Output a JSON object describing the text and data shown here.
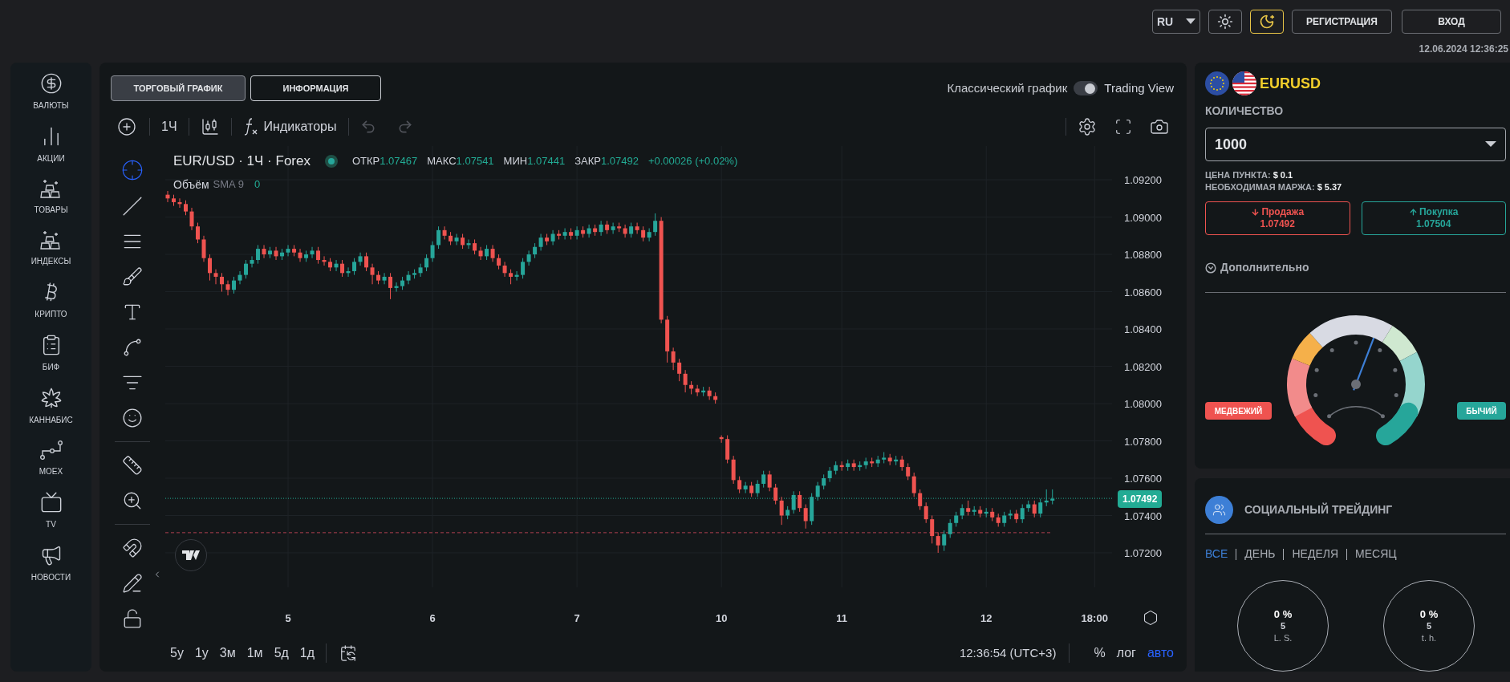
{
  "header": {
    "language": "RU",
    "theme_buttons": [
      {
        "kind": "light",
        "selected": false
      },
      {
        "kind": "dark",
        "selected": true
      }
    ],
    "buttons": [
      "РЕГИСТРАЦИЯ",
      "ВХОД"
    ],
    "datetime": "12.06.2024 12:36:25"
  },
  "sidebar": {
    "items": [
      {
        "label": "ВАЛЮТЫ"
      },
      {
        "label": "АКЦИИ"
      },
      {
        "label": "ТОВАРЫ"
      },
      {
        "label": "ИНДЕКСЫ"
      },
      {
        "label": "КРИПТО"
      },
      {
        "label": "БИФ"
      },
      {
        "label": "КАННАБИС"
      },
      {
        "label": "MOEX"
      },
      {
        "label": "TV"
      },
      {
        "label": "НОВОСТИ"
      }
    ]
  },
  "chart_panel": {
    "tabs": [
      {
        "label": "ТОРГОВЫЙ ГРАФИК",
        "selected": true
      },
      {
        "label": "ИНФОРМАЦИЯ",
        "selected": false
      }
    ],
    "view_toggle": {
      "left_label": "Классический график",
      "right_label": "Trading View",
      "on": true
    },
    "toolbar": {
      "interval": "1Ч",
      "indicators": "Индикаторы"
    },
    "drawing_tools": [
      {
        "selected": true
      },
      {
        "selected": false
      },
      {
        "selected": false
      },
      {
        "selected": false
      },
      {
        "selected": false
      },
      {
        "selected": false
      },
      {
        "selected": false
      },
      {
        "selected": false
      },
      {
        "selected": false
      },
      {
        "selected": false
      },
      {
        "selected": false
      },
      {
        "selected": false
      },
      {
        "selected": false
      }
    ],
    "legend": {
      "symbol": "EUR/USD · 1Ч · Forex",
      "values": [
        {
          "label": "ОТКР",
          "value": "1.07467"
        },
        {
          "label": "МАКС",
          "value": "1.07541"
        },
        {
          "label": "МИН",
          "value": "1.07441"
        },
        {
          "label": "ЗАКР",
          "value": "1.07492"
        }
      ],
      "change": "+0.00026 (+0.02%)",
      "volume_label": "Объём",
      "sma": "SMA 9",
      "volume_value": "0"
    },
    "chart_data": {
      "type": "candlestick",
      "ylim": [
        1.07015,
        1.09381
      ],
      "grid": true,
      "ref_lines": [
        {
          "axis": "y",
          "value": 1.07492,
          "color": "#22ab94"
        },
        {
          "axis": "y",
          "value": 1.07308,
          "color": "#b04050"
        }
      ],
      "yticks": [
        {
          "value": 1.092,
          "label": "1.09200"
        },
        {
          "value": 1.09,
          "label": "1.09000"
        },
        {
          "value": 1.088,
          "label": "1.08800"
        },
        {
          "value": 1.086,
          "label": "1.08600"
        },
        {
          "value": 1.084,
          "label": "1.08400"
        },
        {
          "value": 1.082,
          "label": "1.08200"
        },
        {
          "value": 1.08,
          "label": "1.08000"
        },
        {
          "value": 1.078,
          "label": "1.07800"
        },
        {
          "value": 1.076,
          "label": "1.07600"
        },
        {
          "value": 1.074,
          "label": "1.07400"
        },
        {
          "value": 1.072,
          "label": "1.07200"
        }
      ],
      "categories": [
        null,
        null,
        null,
        null,
        null,
        null,
        null,
        null,
        null,
        null,
        null,
        null,
        null,
        null,
        null,
        null,
        null,
        null,
        null,
        null,
        "5",
        null,
        null,
        null,
        null,
        null,
        null,
        null,
        null,
        null,
        null,
        null,
        null,
        null,
        null,
        null,
        null,
        null,
        null,
        null,
        null,
        null,
        null,
        null,
        "6",
        null,
        null,
        null,
        null,
        null,
        null,
        null,
        null,
        null,
        null,
        null,
        null,
        null,
        null,
        null,
        null,
        null,
        null,
        null,
        null,
        null,
        null,
        null,
        "7",
        null,
        null,
        null,
        null,
        null,
        null,
        null,
        null,
        null,
        null,
        null,
        null,
        null,
        null,
        null,
        null,
        null,
        null,
        null,
        null,
        null,
        null,
        null,
        "10",
        null,
        null,
        null,
        null,
        null,
        null,
        null,
        null,
        null,
        null,
        null,
        null,
        null,
        null,
        null,
        null,
        null,
        null,
        null,
        "11",
        null,
        null,
        null,
        null,
        null,
        null,
        null,
        null,
        null,
        null,
        null,
        null,
        null,
        null,
        null,
        null,
        null,
        null,
        null,
        null,
        null,
        null,
        null,
        "12",
        null,
        null,
        null,
        null,
        null,
        null,
        null,
        null,
        null,
        null,
        null,
        null,
        null,
        null,
        null,
        null,
        null,
        "18:00"
      ],
      "ohlc": [
        [
          1.0912,
          1.0914,
          1.0908,
          1.091
        ],
        [
          1.091,
          1.0912,
          1.0906,
          1.0908
        ],
        [
          1.0908,
          1.091,
          1.0905,
          1.0907
        ],
        [
          1.0907,
          1.0909,
          1.0901,
          1.0903
        ],
        [
          1.0903,
          1.0905,
          1.0893,
          1.0895
        ],
        [
          1.0895,
          1.0897,
          1.0886,
          1.0888
        ],
        [
          1.0888,
          1.089,
          1.0876,
          1.0878
        ],
        [
          1.0878,
          1.088,
          1.0866,
          1.087
        ],
        [
          1.087,
          1.0872,
          1.0864,
          1.0868
        ],
        [
          1.0868,
          1.087,
          1.086,
          1.0864
        ],
        [
          1.0864,
          1.0866,
          1.0858,
          1.0861
        ],
        [
          1.0861,
          1.0868,
          1.0859,
          1.0866
        ],
        [
          1.0866,
          1.0871,
          1.0864,
          1.0869
        ],
        [
          1.0869,
          1.0877,
          1.0867,
          1.0875
        ],
        [
          1.0875,
          1.0879,
          1.0873,
          1.0877
        ],
        [
          1.0877,
          1.0885,
          1.0875,
          1.0883
        ],
        [
          1.0883,
          1.0885,
          1.0878,
          1.088
        ],
        [
          1.088,
          1.0884,
          1.0878,
          1.0882
        ],
        [
          1.0882,
          1.0884,
          1.0877,
          1.0879
        ],
        [
          1.0879,
          1.0883,
          1.0877,
          1.0881
        ],
        [
          1.0881,
          1.0885,
          1.0879,
          1.0883
        ],
        [
          1.0883,
          1.0885,
          1.0879,
          1.0881
        ],
        [
          1.0881,
          1.0883,
          1.0876,
          1.0878
        ],
        [
          1.0878,
          1.0882,
          1.0876,
          1.088
        ],
        [
          1.088,
          1.0884,
          1.0878,
          1.0882
        ],
        [
          1.0882,
          1.0884,
          1.0875,
          1.0877
        ],
        [
          1.0877,
          1.0879,
          1.0874,
          1.0876
        ],
        [
          1.0876,
          1.0878,
          1.0871,
          1.0873
        ],
        [
          1.0873,
          1.0877,
          1.0871,
          1.0875
        ],
        [
          1.0875,
          1.0877,
          1.0868,
          1.087
        ],
        [
          1.087,
          1.0873,
          1.0868,
          1.0871
        ],
        [
          1.0871,
          1.0878,
          1.0869,
          1.0876
        ],
        [
          1.0876,
          1.0881,
          1.0874,
          1.0879
        ],
        [
          1.0879,
          1.0881,
          1.0871,
          1.0873
        ],
        [
          1.0873,
          1.0875,
          1.0864,
          1.0869
        ],
        [
          1.0869,
          1.0871,
          1.0864,
          1.0866
        ],
        [
          1.0866,
          1.087,
          1.0864,
          1.0868
        ],
        [
          1.0868,
          1.087,
          1.0856,
          1.0862
        ],
        [
          1.0862,
          1.0865,
          1.086,
          1.0863
        ],
        [
          1.0863,
          1.0868,
          1.0861,
          1.0866
        ],
        [
          1.0866,
          1.0871,
          1.0864,
          1.0869
        ],
        [
          1.0869,
          1.0872,
          1.0867,
          1.087
        ],
        [
          1.087,
          1.0875,
          1.0868,
          1.0873
        ],
        [
          1.0873,
          1.088,
          1.0871,
          1.0878
        ],
        [
          1.0878,
          1.0887,
          1.0876,
          1.0885
        ],
        [
          1.0885,
          1.0895,
          1.0883,
          1.0893
        ],
        [
          1.0893,
          1.0895,
          1.0888,
          1.089
        ],
        [
          1.089,
          1.0892,
          1.0885,
          1.0887
        ],
        [
          1.0887,
          1.0891,
          1.0885,
          1.0889
        ],
        [
          1.0889,
          1.0891,
          1.0883,
          1.0885
        ],
        [
          1.0885,
          1.0888,
          1.0883,
          1.0886
        ],
        [
          1.0886,
          1.0888,
          1.088,
          1.0882
        ],
        [
          1.0882,
          1.0884,
          1.0877,
          1.0879
        ],
        [
          1.0879,
          1.0885,
          1.0877,
          1.0883
        ],
        [
          1.0883,
          1.0885,
          1.0876,
          1.0878
        ],
        [
          1.0878,
          1.088,
          1.0872,
          1.0874
        ],
        [
          1.0874,
          1.0876,
          1.0868,
          1.087
        ],
        [
          1.087,
          1.0872,
          1.0864,
          1.0868
        ],
        [
          1.0868,
          1.0871,
          1.0866,
          1.0869
        ],
        [
          1.0869,
          1.0878,
          1.0867,
          1.0876
        ],
        [
          1.0876,
          1.0882,
          1.0874,
          1.088
        ],
        [
          1.088,
          1.0886,
          1.0878,
          1.0884
        ],
        [
          1.0884,
          1.0891,
          1.0882,
          1.0889
        ],
        [
          1.0889,
          1.0891,
          1.0885,
          1.0887
        ],
        [
          1.0887,
          1.0893,
          1.0885,
          1.0891
        ],
        [
          1.0891,
          1.0893,
          1.0888,
          1.089
        ],
        [
          1.089,
          1.0894,
          1.0888,
          1.0892
        ],
        [
          1.0892,
          1.0894,
          1.0888,
          1.089
        ],
        [
          1.089,
          1.0895,
          1.0888,
          1.0893
        ],
        [
          1.0893,
          1.0895,
          1.0889,
          1.0891
        ],
        [
          1.0891,
          1.0896,
          1.0889,
          1.0894
        ],
        [
          1.0894,
          1.0896,
          1.089,
          1.0892
        ],
        [
          1.0892,
          1.0898,
          1.089,
          1.0896
        ],
        [
          1.0896,
          1.0898,
          1.0891,
          1.0893
        ],
        [
          1.0893,
          1.0897,
          1.0891,
          1.0895
        ],
        [
          1.0895,
          1.0897,
          1.0892,
          1.0894
        ],
        [
          1.0894,
          1.0896,
          1.0889,
          1.0891
        ],
        [
          1.0891,
          1.0897,
          1.0889,
          1.0895
        ],
        [
          1.0895,
          1.0897,
          1.0891,
          1.0893
        ],
        [
          1.0893,
          1.0895,
          1.0887,
          1.0889
        ],
        [
          1.0889,
          1.0894,
          1.0887,
          1.0892
        ],
        [
          1.0892,
          1.0902,
          1.089,
          1.0898
        ],
        [
          1.0898,
          1.09,
          1.0843,
          1.0845
        ],
        [
          1.0845,
          1.0847,
          1.0822,
          1.0828
        ],
        [
          1.0828,
          1.083,
          1.0818,
          1.0822
        ],
        [
          1.0822,
          1.0824,
          1.0812,
          1.0816
        ],
        [
          1.0816,
          1.0818,
          1.0806,
          1.081
        ],
        [
          1.081,
          1.0812,
          1.0805,
          1.0808
        ],
        [
          1.0808,
          1.081,
          1.0804,
          1.0806
        ],
        [
          1.0806,
          1.0809,
          1.0804,
          1.0807
        ],
        [
          1.0807,
          1.0809,
          1.0802,
          1.0804
        ],
        [
          1.0804,
          1.0806,
          1.08,
          1.0802
        ],
        [
          1.0782,
          1.0783,
          1.0779,
          1.0781
        ],
        [
          1.0781,
          1.0783,
          1.0768,
          1.077
        ],
        [
          1.077,
          1.0772,
          1.0757,
          1.0759
        ],
        [
          1.0759,
          1.0761,
          1.0752,
          1.0754
        ],
        [
          1.0754,
          1.0758,
          1.0752,
          1.0756
        ],
        [
          1.0756,
          1.0758,
          1.075,
          1.0752
        ],
        [
          1.0752,
          1.0759,
          1.075,
          1.0757
        ],
        [
          1.0757,
          1.0764,
          1.0755,
          1.0762
        ],
        [
          1.0762,
          1.0764,
          1.0753,
          1.0755
        ],
        [
          1.0755,
          1.0757,
          1.0746,
          1.0748
        ],
        [
          1.0748,
          1.075,
          1.0735,
          1.074
        ],
        [
          1.074,
          1.0745,
          1.0738,
          1.0743
        ],
        [
          1.0743,
          1.0753,
          1.0741,
          1.0751
        ],
        [
          1.0751,
          1.0753,
          1.0742,
          1.0744
        ],
        [
          1.0744,
          1.0746,
          1.0733,
          1.0737
        ],
        [
          1.0737,
          1.0752,
          1.0735,
          1.075
        ],
        [
          1.075,
          1.0758,
          1.0748,
          1.0756
        ],
        [
          1.0756,
          1.0762,
          1.0754,
          1.076
        ],
        [
          1.076,
          1.0766,
          1.0758,
          1.0764
        ],
        [
          1.0764,
          1.0769,
          1.0762,
          1.0767
        ],
        [
          1.0767,
          1.0769,
          1.0764,
          1.0766
        ],
        [
          1.0766,
          1.077,
          1.0764,
          1.0768
        ],
        [
          1.0768,
          1.077,
          1.0764,
          1.0766
        ],
        [
          1.0766,
          1.0769,
          1.0764,
          1.0767
        ],
        [
          1.0767,
          1.0771,
          1.0765,
          1.0769
        ],
        [
          1.0769,
          1.0771,
          1.0766,
          1.0768
        ],
        [
          1.0768,
          1.0772,
          1.0766,
          1.077
        ],
        [
          1.077,
          1.0774,
          1.0768,
          1.0771
        ],
        [
          1.0771,
          1.0773,
          1.0767,
          1.0769
        ],
        [
          1.0769,
          1.0772,
          1.0767,
          1.077
        ],
        [
          1.077,
          1.0772,
          1.0764,
          1.0766
        ],
        [
          1.0766,
          1.0768,
          1.0759,
          1.0761
        ],
        [
          1.0761,
          1.0763,
          1.075,
          1.0752
        ],
        [
          1.0752,
          1.0754,
          1.0743,
          1.0745
        ],
        [
          1.0745,
          1.0747,
          1.0736,
          1.0738
        ],
        [
          1.0738,
          1.074,
          1.0725,
          1.0729
        ],
        [
          1.0729,
          1.0731,
          1.072,
          1.0724
        ],
        [
          1.0724,
          1.0732,
          1.0721,
          1.073
        ],
        [
          1.073,
          1.0738,
          1.0728,
          1.0736
        ],
        [
          1.0736,
          1.0742,
          1.0734,
          1.074
        ],
        [
          1.074,
          1.0746,
          1.0738,
          1.0744
        ],
        [
          1.0744,
          1.0748,
          1.074,
          1.0742
        ],
        [
          1.0742,
          1.0745,
          1.074,
          1.0743
        ],
        [
          1.0743,
          1.0745,
          1.0739,
          1.0741
        ],
        [
          1.0741,
          1.0744,
          1.0739,
          1.0742
        ],
        [
          1.0742,
          1.0744,
          1.0737,
          1.0739
        ],
        [
          1.0739,
          1.0741,
          1.0734,
          1.0736
        ],
        [
          1.0736,
          1.0742,
          1.0734,
          1.074
        ],
        [
          1.074,
          1.0743,
          1.0738,
          1.0741
        ],
        [
          1.0741,
          1.0743,
          1.0736,
          1.0738
        ],
        [
          1.0738,
          1.0746,
          1.0736,
          1.0744
        ],
        [
          1.0744,
          1.0748,
          1.0742,
          1.0746
        ],
        [
          1.0746,
          1.0748,
          1.0739,
          1.0741
        ],
        [
          1.0741,
          1.0749,
          1.0739,
          1.0747
        ],
        [
          1.0747,
          1.0754,
          1.0745,
          1.0748
        ],
        [
          1.0748,
          1.0754,
          1.0746,
          1.0749
        ],
        null,
        null,
        null,
        null,
        null,
        null,
        null
      ]
    },
    "last_price": "1.07492",
    "ranges": [
      "5у",
      "1у",
      "3м",
      "1м",
      "5д",
      "1д"
    ],
    "clock": "12:36:54 (UTC+3)",
    "scale_options": [
      {
        "label": "%",
        "selected": false
      },
      {
        "label": "лог",
        "selected": false
      },
      {
        "label": "авто",
        "selected": true
      }
    ]
  },
  "trade_panel": {
    "symbol": "EURUSD",
    "quantity": {
      "label": "КОЛИЧЕСТВО",
      "value": "1000"
    },
    "info": [
      "ЦЕНА ПУНКТА: **$ 0.1**",
      "НЕОБХОДИМАЯ МАРЖА: **$ 5.37**"
    ],
    "sell": {
      "label": "Продажа",
      "price": "1.07492"
    },
    "buy": {
      "label": "Покупка",
      "price": "1.07504"
    },
    "more": "Дополнительно",
    "sentiment": {
      "level": 0.57,
      "bear_label": "МЕДВЕЖИЙ",
      "bull_label": "БЫЧИЙ"
    }
  },
  "social": {
    "title": "СОЦИАЛЬНЫЙ ТРЕЙДИНГ",
    "filters": [
      {
        "label": "ВСЕ",
        "selected": true
      },
      {
        "label": "ДЕНЬ",
        "selected": false
      },
      {
        "label": "НЕДЕЛЯ",
        "selected": false
      },
      {
        "label": "МЕСЯЦ",
        "selected": false
      }
    ],
    "stats": [
      {
        "value": "0 %",
        "count": "5",
        "label": "L. S."
      },
      {
        "value": "0 %",
        "count": "5",
        "label": "t. h."
      }
    ]
  }
}
